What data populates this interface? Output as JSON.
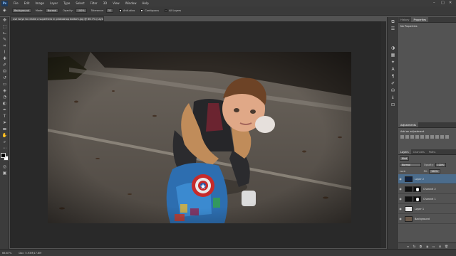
{
  "app": {
    "logo": "Ps"
  },
  "menu": [
    "File",
    "Edit",
    "Image",
    "Layer",
    "Type",
    "Select",
    "Filter",
    "3D",
    "View",
    "Window",
    "Help"
  ],
  "window_controls": [
    "–",
    "□",
    "✕"
  ],
  "options_bar": {
    "sample": "Background",
    "mode_label": "Mode:",
    "mode_value": "Normal",
    "opacity_label": "Opacity:",
    "opacity_value": "100%",
    "tolerance_label": "Tolerance:",
    "tolerance_value": "32",
    "anti_alias": "Anti-alias",
    "contiguous": "Contiguous",
    "all_layers": "All Layers"
  },
  "document_tab": "use ways to create a superhero in photoshop bottom.jpg @ 66.7% (Layer 1, RGB/8*) *",
  "status": {
    "zoom": "66.67%",
    "doc": "Doc: 5.93M/17.6M"
  },
  "properties_panel": {
    "tabs": [
      "History",
      "Properties"
    ],
    "active_tab": "Properties",
    "content": "No Properties"
  },
  "adjustments_panel": {
    "tabs": [
      "Adjustments"
    ],
    "add_label": "Add an adjustment"
  },
  "layers_panel": {
    "tabs": [
      "Layers",
      "Channels",
      "Paths"
    ],
    "kind": "Kind",
    "blend_mode": "Normal",
    "opacity_label": "Opacity:",
    "opacity_value": "100%",
    "lock_label": "Lock:",
    "fill_label": "Fill:",
    "fill_value": "100%",
    "layers": [
      {
        "name": "Layer 2",
        "selected": true
      },
      {
        "name": "Channel 2",
        "selected": false
      },
      {
        "name": "Channel 1",
        "selected": false
      },
      {
        "name": "Layer 1",
        "selected": false
      },
      {
        "name": "Background",
        "selected": false
      }
    ]
  },
  "colors": {
    "accent": "#4b6c8c",
    "foreground": "#000000",
    "background": "#ffffff"
  }
}
